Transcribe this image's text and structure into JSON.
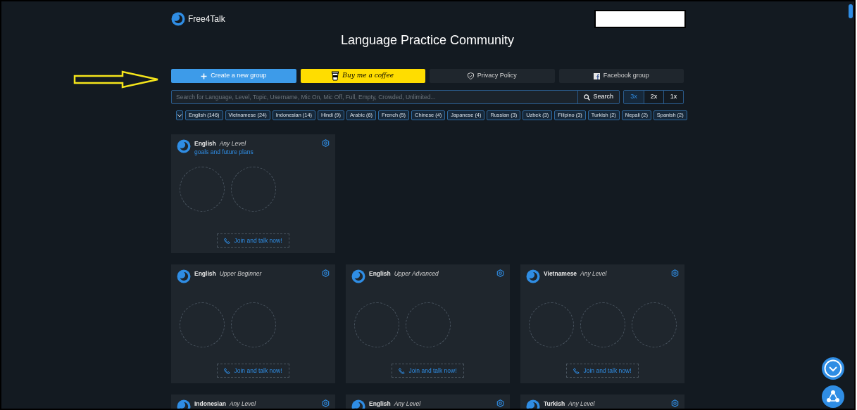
{
  "brand": {
    "name": "Free4Talk"
  },
  "title": "Language Practice Community",
  "actions": [
    {
      "kind": "create",
      "label": "Create a new group"
    },
    {
      "kind": "coffee",
      "label": "Buy me a coffee"
    },
    {
      "kind": "privacy",
      "label": "Privacy Policy"
    },
    {
      "kind": "facebook",
      "label": "Facebook group"
    }
  ],
  "search": {
    "placeholder": "Search for Language, Level, Topic, Username, Mic On, Mic Off, Full, Empty, Crowded, Unlimited...",
    "button": "Search"
  },
  "columns_options": [
    {
      "label": "3x",
      "selected": true
    },
    {
      "label": "2x",
      "selected": false
    },
    {
      "label": "1x",
      "selected": false
    }
  ],
  "filters": {
    "expanded": false,
    "tags": [
      "English (146)",
      "Vietnamese (24)",
      "Indonesian (14)",
      "Hindi (9)",
      "Arabic (6)",
      "French (5)",
      "Chinese (4)",
      "Japanese (4)",
      "Russian (3)",
      "Uzbek (3)",
      "Filipino (3)",
      "Turkish (2)",
      "Nepali (2)",
      "Spanish (2)"
    ]
  },
  "groups": [
    [
      {
        "language": "English",
        "level": "Any Level",
        "topic": "goals and future plans",
        "seats": [
          {
            "occupied": false
          },
          {
            "occupied": false
          }
        ],
        "join": "Join and talk now!"
      }
    ],
    [
      {
        "language": "English",
        "level": "Upper Beginner",
        "seats": [
          {
            "occupied": false
          },
          {
            "occupied": false
          }
        ],
        "join": "Join and talk now!"
      },
      {
        "language": "English",
        "level": "Upper Advanced",
        "seats": [
          {
            "occupied": false
          },
          {
            "occupied": false
          }
        ],
        "join": "Join and talk now!"
      },
      {
        "language": "Vietnamese",
        "level": "Any Level",
        "seats": [
          {
            "occupied": false
          },
          {
            "occupied": false
          },
          {
            "occupied": false
          }
        ],
        "join": "Join and talk now!"
      }
    ],
    [
      {
        "language": "Indonesian",
        "level": "Any Level"
      },
      {
        "language": "English",
        "level": "Any Level"
      },
      {
        "language": "Turkish",
        "level": "Any Level"
      }
    ]
  ]
}
